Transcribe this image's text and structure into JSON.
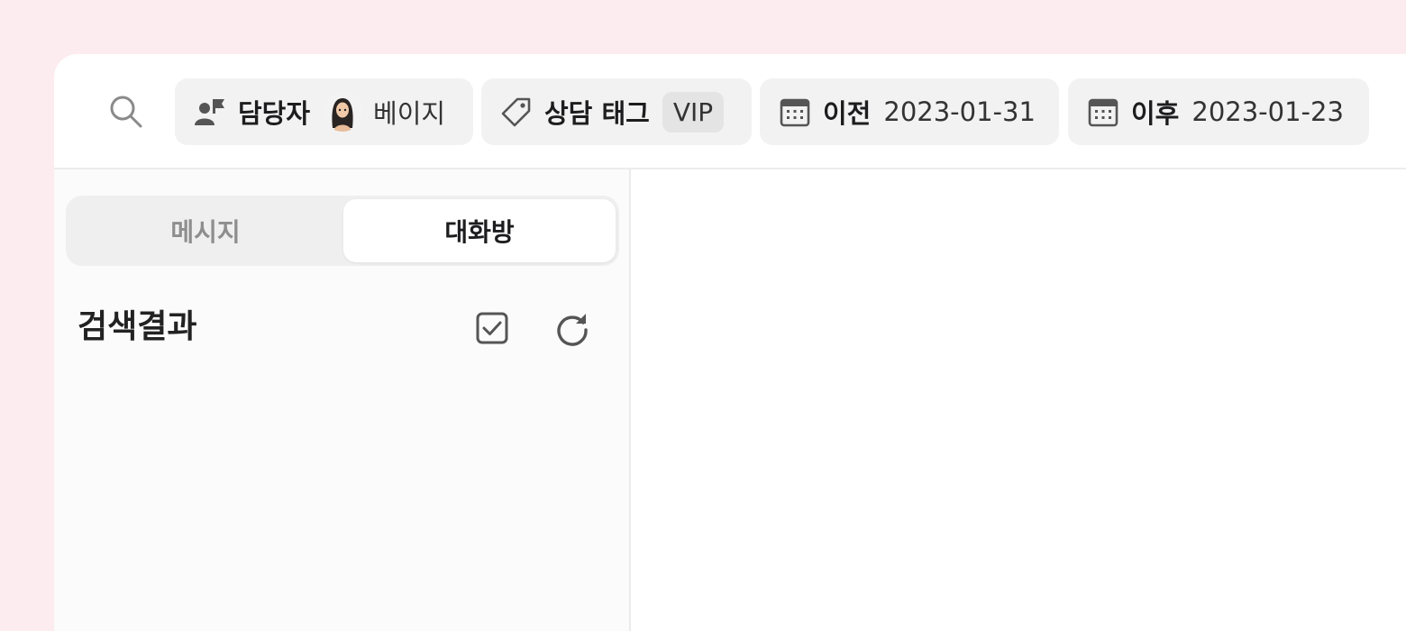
{
  "filters": {
    "assignee": {
      "label": "담당자",
      "value": "베이지",
      "icon": "person-flag-icon"
    },
    "tag": {
      "label": "상담 태그",
      "value": "VIP",
      "icon": "tag-icon"
    },
    "before": {
      "label": "이전",
      "value": "2023-01-31",
      "icon": "calendar-icon"
    },
    "after": {
      "label": "이후",
      "value": "2023-01-23",
      "icon": "calendar-icon"
    }
  },
  "tabs": {
    "messages": "메시지",
    "rooms": "대화방",
    "active": "rooms"
  },
  "results": {
    "title": "검색결과"
  },
  "colors": {
    "background": "#fdecef",
    "chip": "#f2f2f2",
    "icon": "#5a5a5a"
  }
}
